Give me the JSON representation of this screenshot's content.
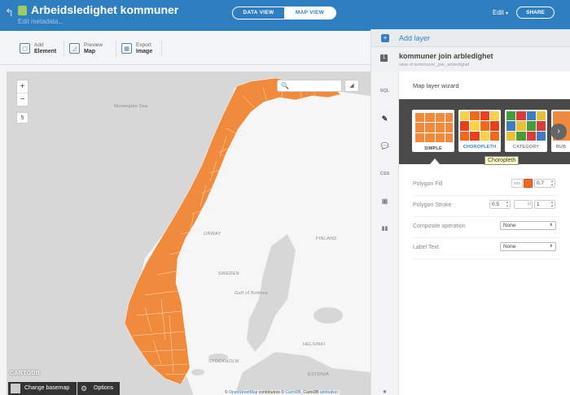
{
  "header": {
    "title": "Arbeidsledighet kommuner",
    "subtitle": "Edit metadata...",
    "view_tabs": [
      "DATA VIEW",
      "MAP VIEW"
    ],
    "active_tab": "MAP VIEW",
    "edit_label": "Edit",
    "share_label": "SHARE"
  },
  "toolbar": {
    "add": {
      "top": "Add",
      "bottom": "Element"
    },
    "preview": {
      "top": "Preview",
      "bottom": "Map"
    },
    "export": {
      "top": "Export",
      "bottom": "Image"
    }
  },
  "map": {
    "zoom_in": "+",
    "zoom_out": "−",
    "zoom_level": "5",
    "labels": {
      "norwegian_sea": "Norwegian Sea",
      "norway": "ORWAY",
      "finland": "FINLAND",
      "sweden": "SWEDEN",
      "gulf": "Gulf of Bothnia",
      "stockholm": "STOCKHOLM",
      "helsinki": "HELSINKI",
      "estonia": "ESTONIA"
    },
    "logo": "CARTODB",
    "change_basemap": "Change basemap",
    "options": "Options",
    "attribution_prefix": "© ",
    "attribution_osm": "OpenStreetMap",
    "attribution_mid": " contributors © ",
    "attribution_cartodb": "CartoDB",
    "attribution_sep": ", CartoDB ",
    "attribution_link": "attribution",
    "fill_color": "#f08a3c",
    "land_color": "#f6f6f6",
    "water_color": "#d7d7d7"
  },
  "panel": {
    "add_layer": "Add layer",
    "layer_number": "1",
    "layer_name": "kommuner join arbledighet",
    "layer_sub": "view of kommuner_join_arbledighet",
    "side_tabs": [
      "SQL",
      "✎",
      "💬",
      "CSS",
      "▣",
      "▮▮"
    ],
    "wizard_title": "Map layer wizard",
    "cards": [
      "SIMPLE",
      "CHOROPLETH",
      "CATEGORY",
      "BUB"
    ],
    "tooltip": "Choropleth",
    "polygon_fill_label": "Polygon Fill",
    "polygon_fill_img": "IMG",
    "polygon_fill_opacity": "0.7",
    "polygon_stroke_label": "Polygon Stroke",
    "polygon_stroke_width": "0.5",
    "polygon_stroke_opacity": "1",
    "composite_label": "Composite operation",
    "composite_value": "None",
    "label_text_label": "Label Text",
    "label_text_value": "None",
    "accent": "#3a7dc0",
    "fill_swatch": "#f06a1c"
  }
}
